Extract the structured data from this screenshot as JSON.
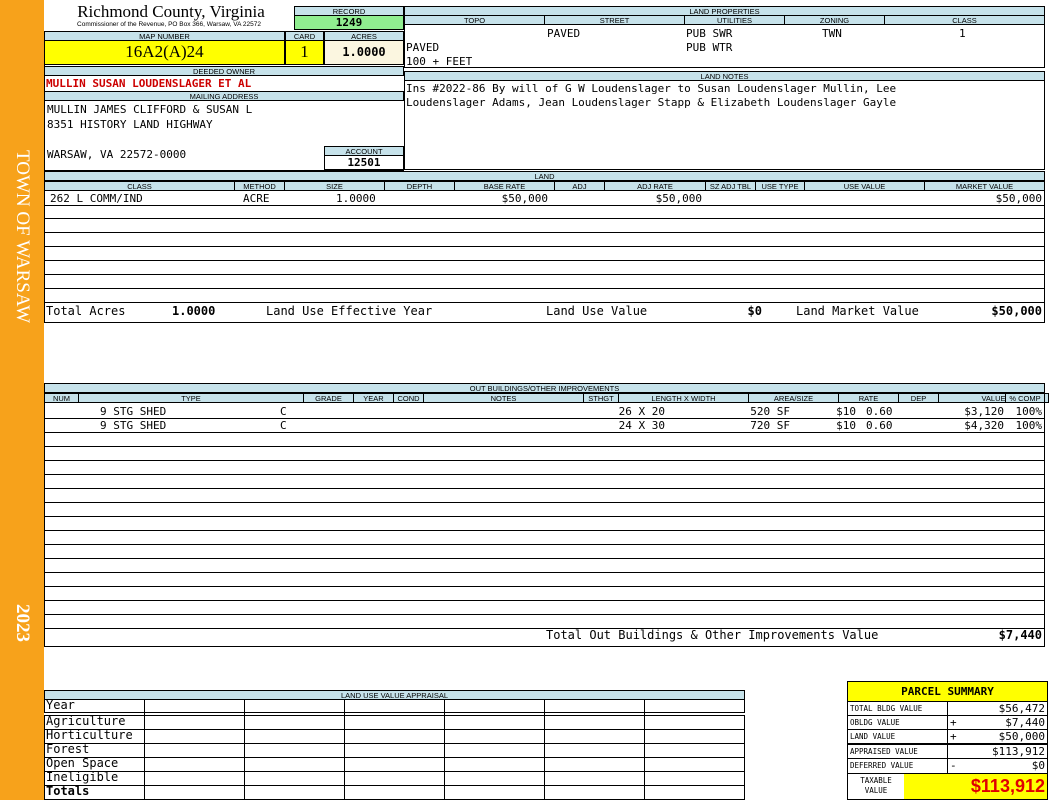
{
  "sidebar": {
    "town": "TOWN OF WARSAW",
    "year": "2023"
  },
  "header": {
    "county": "Richmond County, Virginia",
    "commissioner": "Commissioner of the Revenue, PO Box 366, Warsaw, VA 22572"
  },
  "record": {
    "label": "RECORD",
    "value": "1249"
  },
  "map_number": {
    "label": "MAP NUMBER",
    "value": "16A2(A)24"
  },
  "card": {
    "label": "CARD",
    "value": "1"
  },
  "acres": {
    "label": "ACRES",
    "value": "1.0000"
  },
  "deeded_owner": {
    "label": "DEEDED OWNER",
    "value": "MULLIN SUSAN LOUDENSLAGER ET AL"
  },
  "mailing_address": {
    "label": "MAILING ADDRESS",
    "line1": "MULLIN JAMES CLIFFORD & SUSAN L",
    "line2": "8351 HISTORY LAND HIGHWAY",
    "line3": "WARSAW, VA 22572-0000"
  },
  "account": {
    "label": "ACCOUNT",
    "value": "12501"
  },
  "land_properties": {
    "label": "LAND PROPERTIES",
    "columns": [
      "TOPO",
      "STREET",
      "UTILITIES",
      "ZONING",
      "CLASS"
    ],
    "topo": [
      "PAVED",
      "100 + FEET"
    ],
    "street": "PAVED",
    "utilities": [
      "PUB SWR",
      "PUB WTR"
    ],
    "zoning": "TWN",
    "class": "1"
  },
  "land_notes": {
    "label": "LAND NOTES",
    "line1": "Ins #2022-86 By will of G W Loudenslager to Susan Loudenslager Mullin, Lee",
    "line2": "Loudenslager Adams, Jean Loudenslager Stapp & Elizabeth Loudenslager Gayle"
  },
  "land": {
    "label": "LAND",
    "columns": [
      "CLASS",
      "METHOD",
      "SIZE",
      "DEPTH",
      "BASE RATE",
      "ADJ",
      "ADJ RATE",
      "SZ ADJ TBL",
      "USE TYPE",
      "USE VALUE",
      "MARKET VALUE"
    ],
    "rows": [
      {
        "class": "262 L COMM/IND",
        "method": "ACRE",
        "size": "1.0000",
        "base_rate": "$50,000",
        "adj_rate": "$50,000",
        "market_value": "$50,000"
      }
    ],
    "totals": {
      "total_acres_label": "Total Acres",
      "total_acres": "1.0000",
      "effective_year_label": "Land Use Effective Year",
      "use_value_label": "Land Use Value",
      "use_value": "$0",
      "market_value_label": "Land Market Value",
      "market_value": "$50,000"
    }
  },
  "outbuildings": {
    "label": "OUT BUILDINGS/OTHER IMPROVEMENTS",
    "columns": [
      "NUM",
      "TYPE",
      "GRADE",
      "YEAR",
      "COND",
      "NOTES",
      "STHGT",
      "LENGTH X WIDTH",
      "AREA/SIZE",
      "RATE",
      "DEP",
      "VALUE",
      "% COMP"
    ],
    "rows": [
      {
        "type": "9 STG SHED",
        "grade": "C",
        "dims": "26 X 20",
        "area": "520 SF",
        "rate": "$10",
        "dep": "0.60",
        "value": "$3,120",
        "comp": "100%"
      },
      {
        "type": "9 STG SHED",
        "grade": "C",
        "dims": "24 X 30",
        "area": "720 SF",
        "rate": "$10",
        "dep": "0.60",
        "value": "$4,320",
        "comp": "100%"
      }
    ],
    "total_label": "Total Out Buildings & Other Improvements Value",
    "total_value": "$7,440"
  },
  "land_use_appraisal": {
    "label": "LAND USE VALUE APPRAISAL",
    "year_label": "Year",
    "rows": [
      "Agriculture",
      "Horticulture",
      "Forest",
      "Open Space",
      "Ineligible"
    ],
    "totals_label": "Totals"
  },
  "parcel_summary": {
    "title": "PARCEL SUMMARY",
    "rows": [
      {
        "label": "TOTAL BLDG VALUE",
        "sign": "",
        "value": "$56,472"
      },
      {
        "label": "OBLDG VALUE",
        "sign": "+",
        "value": "$7,440"
      },
      {
        "label": "LAND VALUE",
        "sign": "+",
        "value": "$50,000"
      },
      {
        "label": "APPRAISED VALUE",
        "sign": "",
        "value": "$113,912"
      },
      {
        "label": "DEFERRED VALUE",
        "sign": "-",
        "value": "$0"
      }
    ],
    "taxable_label_1": "TAXABLE",
    "taxable_label_2": "VALUE",
    "taxable_value": "$113,912"
  },
  "colors": {
    "sidebar": "#f7a21b",
    "header_bar": "#c6e2ea",
    "highlight_yellow": "#ffff00",
    "record_green": "#90ee90",
    "owner_red": "#cc0000",
    "taxable_red": "#e00000"
  }
}
